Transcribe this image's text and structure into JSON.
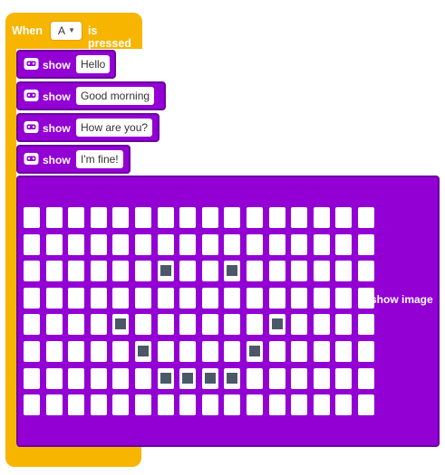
{
  "event": {
    "when_label": "When",
    "button_value": "A",
    "pressed_label": "is pressed"
  },
  "show_blocks": [
    {
      "label": "show",
      "value": "Hello"
    },
    {
      "label": "show",
      "value": "Good morning"
    },
    {
      "label": "show",
      "value": "How are you?"
    },
    {
      "label": "show",
      "value": "I'm fine!"
    }
  ],
  "show_image": {
    "label": "show image",
    "rows": 8,
    "cols": 16,
    "lit_pixels": [
      [
        2,
        6
      ],
      [
        2,
        9
      ],
      [
        4,
        4
      ],
      [
        4,
        11
      ],
      [
        5,
        5
      ],
      [
        5,
        10
      ],
      [
        6,
        6
      ],
      [
        6,
        7
      ],
      [
        6,
        8
      ],
      [
        6,
        9
      ]
    ]
  },
  "colors": {
    "event": "#f7b500",
    "display": "#9200d4",
    "pixel_on": "#4b5868"
  },
  "icons": {
    "display": "robot-face-icon",
    "dropdown": "caret-down-icon"
  }
}
